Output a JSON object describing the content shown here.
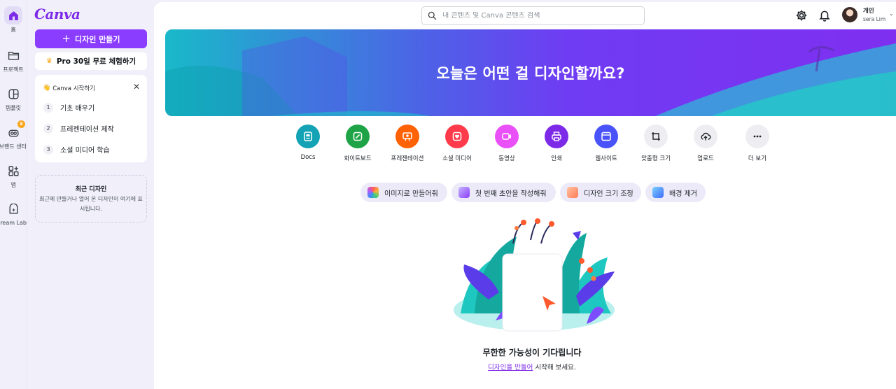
{
  "rail": {
    "items": [
      {
        "label": "홈",
        "icon": "home-icon",
        "active": true
      },
      {
        "label": "프로젝트",
        "icon": "folder-icon"
      },
      {
        "label": "템플릿",
        "icon": "template-icon"
      },
      {
        "label": "브랜드 센터",
        "icon": "brand-icon"
      },
      {
        "label": "앱",
        "icon": "apps-icon"
      },
      {
        "label": "Dream Lab",
        "icon": "dream-lab-icon"
      }
    ]
  },
  "panel": {
    "logo": "Canva",
    "create_label": "디자인 만들기",
    "pro_label": "Pro 30일 무료 체험하기",
    "start_card": {
      "title": "Canva 시작하기",
      "steps": [
        {
          "num": "1",
          "label": "기초 배우기"
        },
        {
          "num": "2",
          "label": "프레젠테이션 제작"
        },
        {
          "num": "3",
          "label": "소셜 미디어 학습"
        }
      ]
    },
    "recent": {
      "title": "최근 디자인",
      "desc": "최근에 만들거나 열어 본 디자인이 여기에 표시됩니다."
    }
  },
  "header": {
    "search_placeholder": "내 콘텐츠 및 Canva 콘텐츠 검색",
    "account_kind": "개인",
    "account_name": "sera Lim"
  },
  "hero": {
    "title": "오늘은 어떤 걸 디자인할까요?"
  },
  "quick_actions": [
    {
      "label": "Docs",
      "color": "#13a3b5",
      "icon": "doc-icon"
    },
    {
      "label": "화이트보드",
      "color": "#1ea446",
      "icon": "whiteboard-icon"
    },
    {
      "label": "프레젠테이션",
      "color": "#ff6105",
      "icon": "presentation-icon"
    },
    {
      "label": "소셜 미디어",
      "color": "#ff3b4b",
      "icon": "heart-icon"
    },
    {
      "label": "동영상",
      "color": "#e950f7",
      "icon": "video-icon"
    },
    {
      "label": "인쇄",
      "color": "#7d2ae8",
      "icon": "print-icon"
    },
    {
      "label": "웹사이트",
      "color": "#4a53fa",
      "icon": "website-icon"
    },
    {
      "label": "맞춤형 크기",
      "color": "#eeeef2",
      "icon": "custom-size-icon"
    },
    {
      "label": "업로드",
      "color": "#eeeef2",
      "icon": "upload-icon"
    },
    {
      "label": "더 보기",
      "color": "#eeeef2",
      "icon": "more-icon"
    }
  ],
  "suggestions": [
    {
      "label": "이미지로 만들어줘"
    },
    {
      "label": "첫 번째 초안을 작성해줘"
    },
    {
      "label": "디자인 크기 조정"
    },
    {
      "label": "배경 제거"
    }
  ],
  "empty": {
    "title": "무한한 가능성이 기다립니다",
    "link": "디자인을 만들어",
    "rest": " 시작해 보세요."
  }
}
